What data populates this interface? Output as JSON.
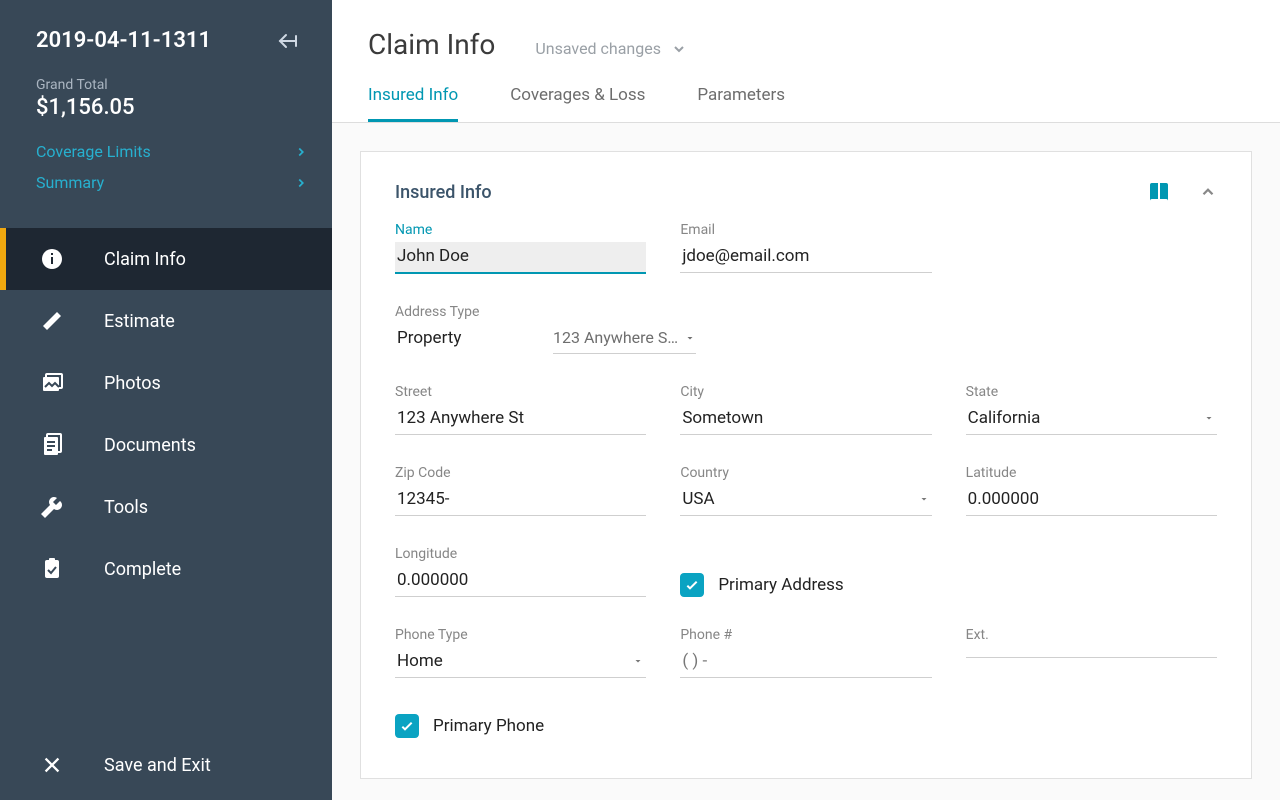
{
  "sidebar": {
    "claim_id": "2019-04-11-1311",
    "grand_total_label": "Grand Total",
    "grand_total_value": "$1,156.05",
    "links": {
      "coverage_limits": "Coverage Limits",
      "summary": "Summary"
    },
    "nav": {
      "claim_info": "Claim Info",
      "estimate": "Estimate",
      "photos": "Photos",
      "documents": "Documents",
      "tools": "Tools",
      "complete": "Complete"
    },
    "footer": "Save and Exit"
  },
  "header": {
    "title": "Claim Info",
    "unsaved": "Unsaved changes",
    "tabs": {
      "insured_info": "Insured Info",
      "coverages_loss": "Coverages & Loss",
      "parameters": "Parameters"
    }
  },
  "panel": {
    "title": "Insured Info"
  },
  "form": {
    "name_label": "Name",
    "name_value": "John Doe",
    "email_label": "Email",
    "email_value": "jdoe@email.com",
    "address_type_label": "Address Type",
    "address_type_value": "Property",
    "address_picker_value": "123 Anywhere S…",
    "street_label": "Street",
    "street_value": "123 Anywhere St",
    "city_label": "City",
    "city_value": "Sometown",
    "state_label": "State",
    "state_value": "California",
    "zip_label": "Zip Code",
    "zip_value": "12345-",
    "country_label": "Country",
    "country_value": "USA",
    "latitude_label": "Latitude",
    "latitude_value": "0.000000",
    "longitude_label": "Longitude",
    "longitude_value": "0.000000",
    "primary_address_label": "Primary Address",
    "phone_type_label": "Phone Type",
    "phone_type_value": "Home",
    "phone_label": "Phone #",
    "phone_value": "(     )     -",
    "ext_label": "Ext.",
    "ext_value": "",
    "primary_phone_label": "Primary Phone"
  }
}
